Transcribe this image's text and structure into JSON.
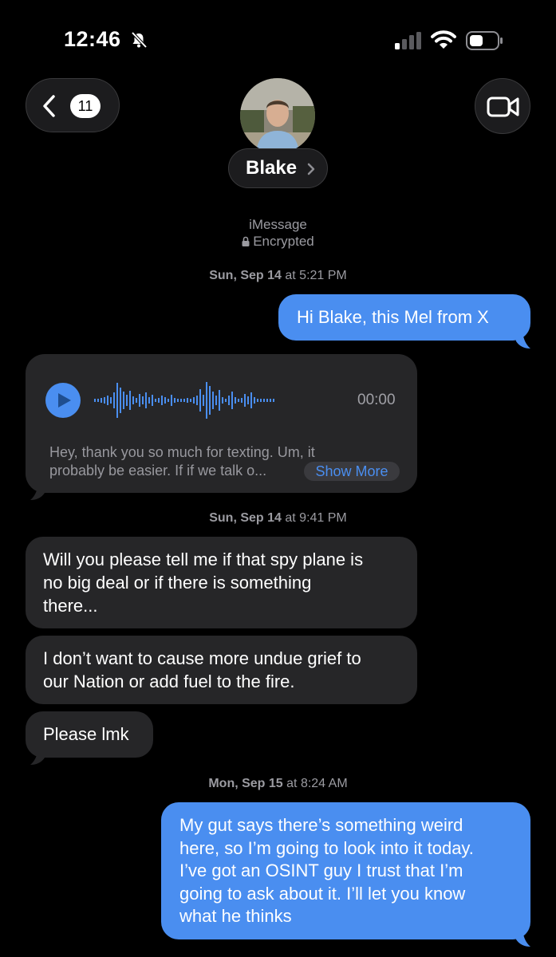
{
  "status_bar": {
    "time": "12:46"
  },
  "header": {
    "unread_count": "11",
    "contact_name": "Blake"
  },
  "conversation": {
    "service": "iMessage",
    "encryption": "Encrypted",
    "timestamps": [
      {
        "day": "Sun, Sep 14",
        "time": " at 5:21 PM"
      },
      {
        "day": "Sun, Sep 14",
        "time": " at 9:41 PM"
      },
      {
        "day": "Mon, Sep 15",
        "time": " at 8:24 AM"
      }
    ],
    "messages": [
      {
        "direction": "outgoing",
        "lines": [
          "Hi Blake, this Mel from X"
        ]
      },
      {
        "direction": "incoming",
        "type": "audio",
        "duration": "00:00",
        "transcript_lines": [
          "Hey, thank you so much for texting. Um, it",
          "probably be easier. If if we talk o..."
        ],
        "show_more": "Show More"
      },
      {
        "direction": "incoming",
        "lines": [
          "Will you please tell me if that spy plane is",
          "no big deal or if there is something",
          "there..."
        ]
      },
      {
        "direction": "incoming",
        "lines": [
          "I don’t want to cause more undue grief to",
          "our Nation or add fuel to the fire."
        ]
      },
      {
        "direction": "incoming",
        "lines": [
          "Please lmk"
        ]
      },
      {
        "direction": "outgoing",
        "lines": [
          "My gut says there’s something weird",
          "here, so I’m going to look into it today.",
          "I’ve got an OSINT guy I trust that I’m",
          "going to ask about it. I’ll let you know",
          "what he thinks"
        ]
      }
    ]
  },
  "colors": {
    "outgoing_bubble": "#4a8ef0",
    "incoming_bubble": "#262628",
    "meta_text": "#9b9ba1"
  },
  "icons": [
    "bell-slash-icon",
    "signal-icon",
    "wifi-icon",
    "battery-icon",
    "chevron-left-icon",
    "video-camera-icon",
    "play-icon",
    "waveform-icon",
    "lock-icon",
    "chevron-right-icon"
  ]
}
